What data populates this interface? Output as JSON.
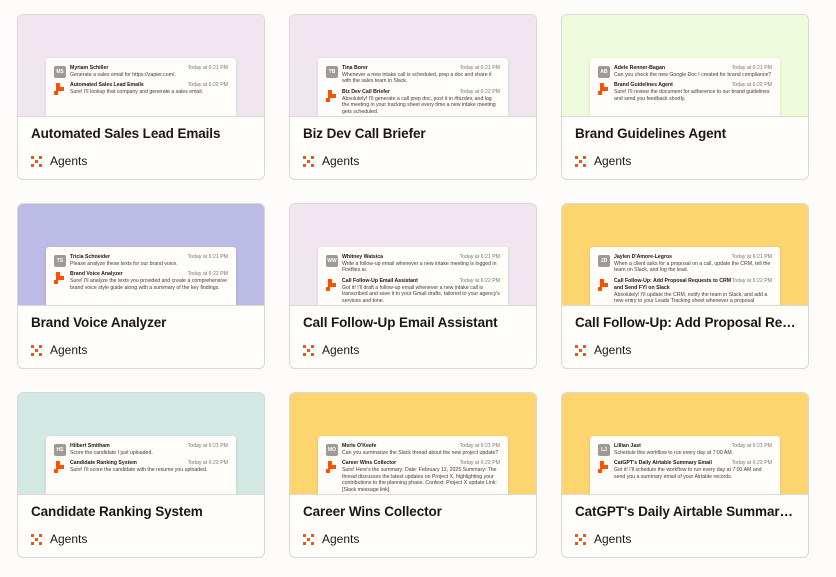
{
  "cards": [
    {
      "title": "Automated Sales Lead Emails",
      "tag": "Agents",
      "banner_color": "#f1e6f0",
      "user": {
        "initials": "MS",
        "name": "Myriam Schiller",
        "time": "Today at 6:21 PM",
        "text": "Generate a sales email for https://zapier.com/."
      },
      "bot": {
        "name": "Automated Sales Lead Emails",
        "time": "Today at 6:22 PM",
        "text": "Sure! I'll lookup that company and generate a sales email."
      }
    },
    {
      "title": "Biz Dev Call Briefer",
      "tag": "Agents",
      "banner_color": "#f1e6f0",
      "user": {
        "initials": "TB",
        "name": "Tina Borer",
        "time": "Today at 6:21 PM",
        "text": "Whenever a new intake call is scheduled, prep a doc and share it with the sales team in Slack."
      },
      "bot": {
        "name": "Biz Dev Call Briefer",
        "time": "Today at 6:22 PM",
        "text": "Absolutely! I'll generate a call prep doc, post it in #bizdev, and log the meeting in your tracking sheet every time a new intake meeting gets scheduled."
      }
    },
    {
      "title": "Brand Guidelines Agent",
      "tag": "Agents",
      "banner_color": "#eefbdc",
      "user": {
        "initials": "AB",
        "name": "Adele Renner-Bagan",
        "time": "Today at 6:21 PM",
        "text": "Can you check the new Google Doc I created for brand compliance?"
      },
      "bot": {
        "name": "Brand Guidelines Agent",
        "time": "Today at 6:22 PM",
        "text": "Sure! I'll review the document for adherence to our brand guidelines and send you feedback shortly."
      }
    },
    {
      "title": "Brand Voice Analyzer",
      "tag": "Agents",
      "banner_color": "#bcbbe5",
      "user": {
        "initials": "TS",
        "name": "Tricia Schneider",
        "time": "Today at 6:21 PM",
        "text": "Please analyze these texts for our brand voice."
      },
      "bot": {
        "name": "Brand Voice Analyzer",
        "time": "Today at 6:22 PM",
        "text": "Sure! I'll analyze the texts you provided and create a comprehensive brand voice style guide along with a summary of the key findings."
      }
    },
    {
      "title": "Call Follow-Up Email Assistant",
      "tag": "Agents",
      "banner_color": "#f1e6f0",
      "user": {
        "initials": "WW",
        "name": "Whitney Watsica",
        "time": "Today at 6:21 PM",
        "text": "Write a follow-up email whenever a new intake meeting is logged in Fireflies.ai."
      },
      "bot": {
        "name": "Call Follow-Up Email Assistant",
        "time": "Today at 6:22 PM",
        "text": "Got it! I'll draft a follow-up email whenever a new intake call is transcribed and save it to your Gmail drafts, tailored to your agency's services and tone."
      }
    },
    {
      "title": "Call Follow-Up: Add Proposal Requests ...",
      "tag": "Agents",
      "banner_color": "#fdd56f",
      "user": {
        "initials": "JD",
        "name": "Jaylen D'Amore-Legros",
        "time": "Today at 6:21 PM",
        "text": "When a client asks for a proposal on a call, update the CRM, tell the team on Slack, and log the lead."
      },
      "bot": {
        "name": "Call Follow-Up: Add Proposal Requests to CRM and Send FYI on Slack",
        "time": "Today at 6:22 PM",
        "text": "Absolutely! I'll update the CRM, notify the team in Slack, and add a new entry to your Leads Tracking sheet whenever a proposal request is detected."
      }
    },
    {
      "title": "Candidate Ranking System",
      "tag": "Agents",
      "banner_color": "#d2e9e3",
      "user": {
        "initials": "HS",
        "name": "Hilbert Smitham",
        "time": "Today at 6:21 PM",
        "text": "Score the candidate I just uploaded."
      },
      "bot": {
        "name": "Candidate Ranking System",
        "time": "Today at 6:22 PM",
        "text": "Sure! I'll score the candidate with the resume you uploaded."
      }
    },
    {
      "title": "Career Wins Collector",
      "tag": "Agents",
      "banner_color": "#fdd56f",
      "user": {
        "initials": "MO",
        "name": "Merle O'Keefe",
        "time": "Today at 6:21 PM",
        "text": "Can you summarize the Slack thread about the new project update?"
      },
      "bot": {
        "name": "Career Wins Collector",
        "time": "Today at 6:22 PM",
        "text": "Sure! Here's the summary: Date: February 12, 2025 Summary: The thread discusses the latest updates on Project X, highlighting your contributions to the planning phase. Context: Project X update Link: [Slack message link]"
      }
    },
    {
      "title": "CatGPT's Daily Airtable Summary Email",
      "tag": "Agents",
      "banner_color": "#fdd56f",
      "user": {
        "initials": "LJ",
        "name": "Lillian Jast",
        "time": "Today at 6:21 PM",
        "text": "Schedule this workflow to run every day at 7:00 AM."
      },
      "bot": {
        "name": "CatGPT's Daily Airtable Summary Email",
        "time": "Today at 6:22 PM",
        "text": "Got it! I'll schedule the workflow to run every day at 7:00 AM and send you a summary email of your Airtable records."
      }
    }
  ],
  "colors": {
    "accent": "#ff4f00"
  },
  "icons": {
    "bot": "zapier-bot-icon",
    "tag": "agents-icon"
  }
}
